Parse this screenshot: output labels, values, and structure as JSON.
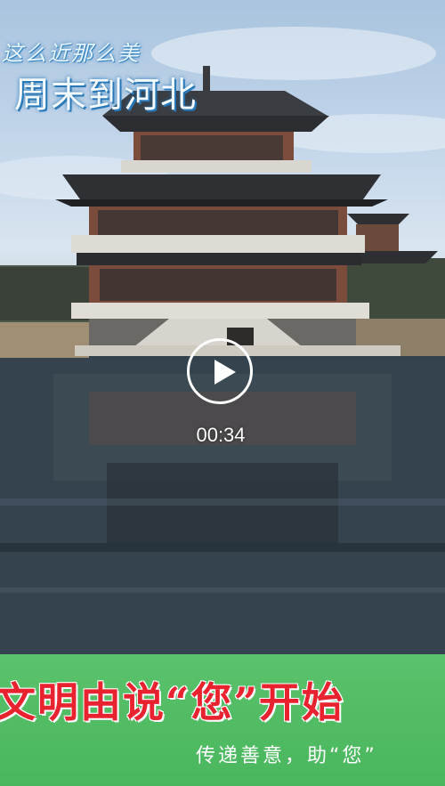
{
  "video": {
    "title_line1": "这么近那么美",
    "title_line2": "周末到河北",
    "duration": "00:34",
    "play_icon": "play-icon"
  },
  "banner": {
    "slogan": "文明由说“您”开始",
    "subtext": "传递善意，助“您”"
  },
  "colors": {
    "banner_green": "#4fb963",
    "slogan_red": "#e8232f",
    "water": "#2e3c47",
    "sky": "#b9cfe5"
  }
}
